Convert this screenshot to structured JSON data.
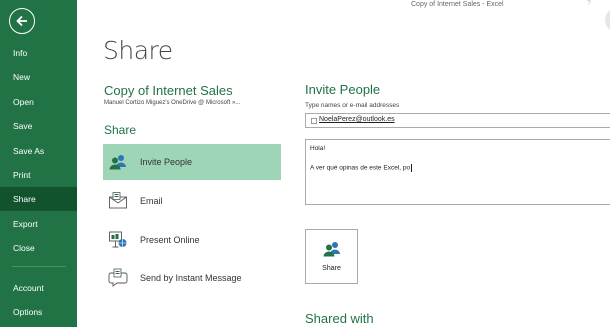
{
  "window": {
    "title": "Copy of Internet Sales - Excel"
  },
  "sidebar": {
    "items": [
      {
        "label": "Info"
      },
      {
        "label": "New"
      },
      {
        "label": "Open"
      },
      {
        "label": "Save"
      },
      {
        "label": "Save As"
      },
      {
        "label": "Print"
      },
      {
        "label": "Share",
        "active": true
      },
      {
        "label": "Export"
      },
      {
        "label": "Close"
      },
      {
        "label": "Account"
      },
      {
        "label": "Options"
      }
    ]
  },
  "main": {
    "title": "Share",
    "document_name": "Copy of Internet Sales",
    "document_location": "Manuel Cortizo Miguez's OneDrive @ Microsoft »...",
    "share_section_title": "Share",
    "options": [
      {
        "label": "Invite People",
        "icon": "people-icon",
        "selected": true
      },
      {
        "label": "Email",
        "icon": "email-icon"
      },
      {
        "label": "Present Online",
        "icon": "present-online-icon"
      },
      {
        "label": "Send by Instant Message",
        "icon": "instant-message-icon"
      }
    ]
  },
  "invite": {
    "title": "Invite People",
    "field_label": "Type names or e-mail addresses",
    "recipient": "NoelaPerez@outlook.es",
    "message_line1": "Hola!",
    "message_line2": "A ver qué opinas de este Excel, po",
    "share_button_label": "Share",
    "shared_with_title": "Shared with"
  },
  "colors": {
    "accent": "#217346",
    "sidebar_active": "#10532d",
    "selected_option": "#9fd5b7",
    "icon_blue": "#2e75b6"
  }
}
